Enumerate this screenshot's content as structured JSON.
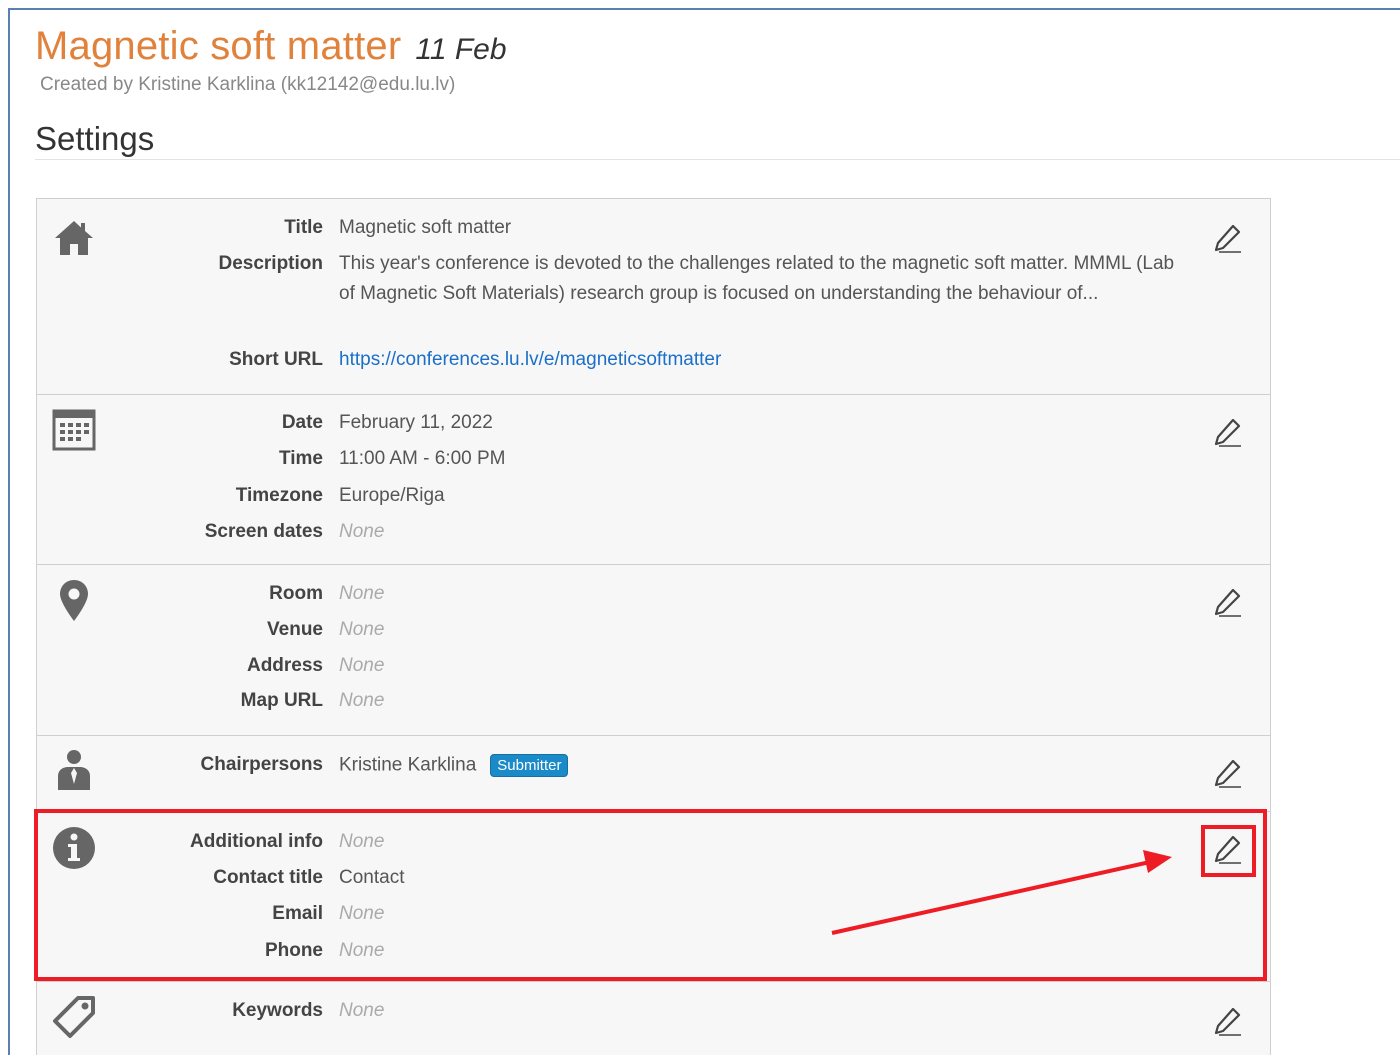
{
  "header": {
    "title": "Magnetic soft matter",
    "date": "11 Feb",
    "created_by": "Created by Kristine Karklina (kk12142@edu.lu.lv)",
    "settings": "Settings"
  },
  "sections": {
    "general": {
      "icon": "home-icon",
      "title_label": "Title",
      "title_value": "Magnetic soft matter",
      "description_label": "Description",
      "description_value": "This year's conference is devoted to the challenges related to the magnetic soft matter. MMML (Lab of Magnetic Soft Materials) research group is focused on understanding the behaviour of...",
      "short_url_label": "Short URL",
      "short_url_value": "https://conferences.lu.lv/e/magneticsoftmatter"
    },
    "datetime": {
      "icon": "calendar-icon",
      "date_label": "Date",
      "date_value": "February 11, 2022",
      "time_label": "Time",
      "time_value": "11:00 AM - 6:00 PM",
      "timezone_label": "Timezone",
      "timezone_value": "Europe/Riga",
      "screen_dates_label": "Screen dates",
      "screen_dates_value": "None"
    },
    "location": {
      "icon": "map-pin-icon",
      "room_label": "Room",
      "room_value": "None",
      "venue_label": "Venue",
      "venue_value": "None",
      "address_label": "Address",
      "address_value": "None",
      "map_url_label": "Map URL",
      "map_url_value": "None"
    },
    "persons": {
      "icon": "person-icon",
      "chairpersons_label": "Chairpersons",
      "chairpersons_value": "Kristine Karklina",
      "badge": "Submitter"
    },
    "contact": {
      "icon": "info-icon",
      "additional_info_label": "Additional info",
      "additional_info_value": "None",
      "contact_title_label": "Contact title",
      "contact_title_value": "Contact",
      "email_label": "Email",
      "email_value": "None",
      "phone_label": "Phone",
      "phone_value": "None"
    },
    "keywords": {
      "icon": "tag-icon",
      "keywords_label": "Keywords",
      "keywords_value": "None"
    }
  },
  "annotation": {
    "highlight_color": "#ee1c24"
  },
  "colors": {
    "title": "#e0813c",
    "link": "#1a6fc9",
    "badge": "#1a8ac9"
  }
}
